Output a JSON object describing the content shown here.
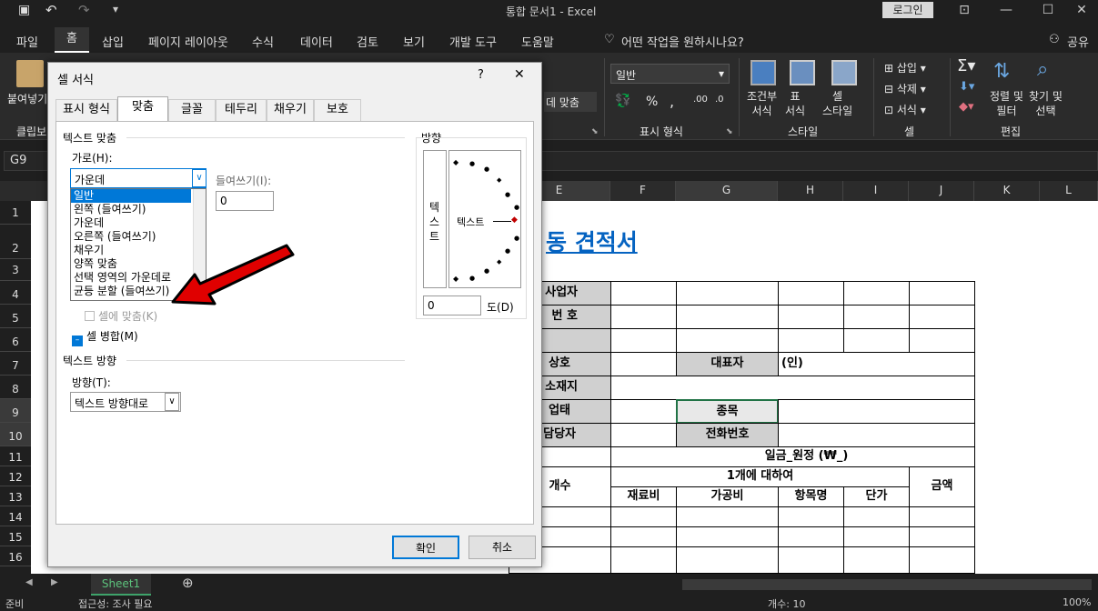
{
  "window": {
    "title": "통합 문서1 - Excel",
    "login": "로그인"
  },
  "menu": [
    "파일",
    "홈",
    "삽입",
    "페이지 레이아웃",
    "수식",
    "데이터",
    "검토",
    "보기",
    "개발 도구",
    "도움말"
  ],
  "tell_me": "어떤 작업을 원하시나요?",
  "share": "공유",
  "ribbon": {
    "paste": "붙여넣기",
    "clipboard": "클립보",
    "wrap_merge": "데 맞춤",
    "number_format": "일반",
    "number_group": "표시 형식",
    "percent": "%",
    "comma": ",",
    "cond_format": "조건부\n서식",
    "table_fmt": "표\n서식",
    "cell_style": "셀\n스타일",
    "styles_group": "스타일",
    "insert": "삽입",
    "delete": "삭제",
    "format": "서식",
    "cells_group": "셀",
    "sort_filter": "정렬 및\n필터",
    "find_select": "찾기 및\n선택",
    "editing_group": "편집"
  },
  "name_box": "G9",
  "columns": [
    "E",
    "F",
    "G",
    "H",
    "I",
    "J",
    "K",
    "L"
  ],
  "rows": [
    "1",
    "2",
    "3",
    "4",
    "5",
    "6",
    "7",
    "8",
    "9",
    "10",
    "11",
    "12",
    "13",
    "14",
    "15",
    "16"
  ],
  "sheet": {
    "title": "동 견적서",
    "biz": "사업자",
    "bizno": "번   호",
    "company": "상호",
    "ceo": "대표자",
    "seal": "(인)",
    "address": "소재지",
    "business": "업태",
    "item": "종목",
    "manager": "담당자",
    "phone": "전화번호",
    "total": "일금_원정 (₩_)",
    "qty": "개수",
    "per_unit": "1개에 대하여",
    "amount": "금액",
    "material": "재료비",
    "process": "가공비",
    "item_name": "항목명",
    "unit_price": "단가"
  },
  "sheet_tab": "Sheet1",
  "status": {
    "ready": "준비",
    "accessibility": "접근성: 조사 필요",
    "count": "개수: 10",
    "zoom": "100%"
  },
  "dialog": {
    "title": "셀 서식",
    "help": "?",
    "close": "✕",
    "tabs": [
      "표시 형식",
      "맞춤",
      "글꼴",
      "테두리",
      "채우기",
      "보호"
    ],
    "text_align": "텍스트 맞춤",
    "horizontal_label": "가로(H):",
    "horizontal_value": "가운데",
    "indent_label": "들여쓰기(I):",
    "indent_value": "0",
    "list": [
      "일반",
      "왼쪽 (들여쓰기)",
      "가운데",
      "오른쪽 (들여쓰기)",
      "채우기",
      "양쪽 맞춤",
      "선택 영역의 가운데로",
      "균등 분할 (들여쓰기)"
    ],
    "shrink": "셀에 맞춤(K)",
    "merge": "셀 병합(M)",
    "text_dir_group": "텍스트 방향",
    "dir_label": "방향(T):",
    "dir_value": "텍스트 방향대로",
    "orientation": "방향",
    "vert_text": "텍\n스\n트",
    "horiz_text": "텍스트",
    "degree_value": "0",
    "degree_label": "도(D)",
    "ok": "확인",
    "cancel": "취소"
  },
  "colors": {
    "accent": "#217346",
    "arrow": "#e00000",
    "link_blue": "#0563c1"
  }
}
